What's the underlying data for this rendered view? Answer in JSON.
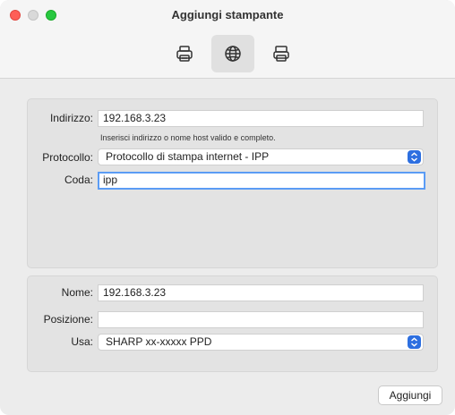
{
  "window": {
    "title": "Aggiungi stampante"
  },
  "toolbar": {
    "items": [
      {
        "icon": "printer-icon",
        "selected": false
      },
      {
        "icon": "globe-icon",
        "selected": true
      },
      {
        "icon": "printer-alt-icon",
        "selected": false
      }
    ]
  },
  "connection": {
    "address_label": "Indirizzo:",
    "address_value": "192.168.3.23",
    "address_hint": "Inserisci indirizzo o nome host valido e completo.",
    "protocol_label": "Protocollo:",
    "protocol_value": "Protocollo di stampa internet - IPP",
    "queue_label": "Coda:",
    "queue_value": "ipp"
  },
  "details": {
    "name_label": "Nome:",
    "name_value": "192.168.3.23",
    "location_label": "Posizione:",
    "location_value": "",
    "use_label": "Usa:",
    "use_value": "SHARP xx-xxxxx PPD"
  },
  "actions": {
    "add_label": "Aggiungi"
  },
  "colors": {
    "accent": "#2d6fe0",
    "focus_ring": "#5b9cf5"
  }
}
